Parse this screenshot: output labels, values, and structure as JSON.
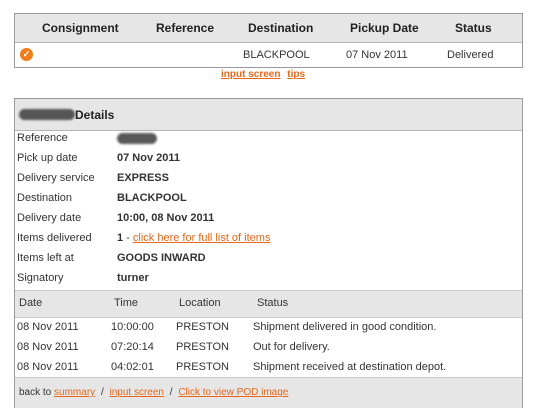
{
  "results": {
    "headers": [
      "Consignment",
      "Reference",
      "Destination",
      "Pickup Date",
      "Status"
    ],
    "row": {
      "destination": "BLACKPOOL",
      "pickup_date": "07 Nov 2011",
      "status": "Delivered"
    }
  },
  "links": {
    "input_screen": "input screen",
    "tips": "tips"
  },
  "details": {
    "title_suffix": "Details",
    "fields": [
      {
        "label": "Reference",
        "value": ""
      },
      {
        "label": "Pick up date",
        "value": "07 Nov 2011"
      },
      {
        "label": "Delivery service",
        "value": "EXPRESS"
      },
      {
        "label": "Destination",
        "value": "BLACKPOOL"
      },
      {
        "label": "Delivery date",
        "value": "10:00, 08 Nov 2011"
      },
      {
        "label": "Items delivered",
        "value": "1",
        "link_prefix": " - ",
        "link": "click here for full list of items"
      },
      {
        "label": "Items left at",
        "value": "GOODS INWARD"
      },
      {
        "label": "Signatory",
        "value": "turner"
      }
    ],
    "history": {
      "headers": [
        "Date",
        "Time",
        "Location",
        "Status"
      ],
      "rows": [
        [
          "08 Nov 2011",
          "10:00:00",
          "PRESTON",
          "Shipment delivered in good condition."
        ],
        [
          "08 Nov 2011",
          "07:20:14",
          "PRESTON",
          "Out for delivery."
        ],
        [
          "08 Nov 2011",
          "04:02:01",
          "PRESTON",
          "Shipment received at destination depot."
        ]
      ]
    },
    "footer": {
      "back_to": "back to",
      "summary": "summary",
      "sep": "/",
      "input_screen": "input screen",
      "pod": "Click to view POD image"
    }
  },
  "colors": {
    "accent": "#e8661a",
    "header_bg": "#e6e6e6",
    "border": "#9a9a9a"
  },
  "icons": {
    "status": "check-circle-icon"
  }
}
